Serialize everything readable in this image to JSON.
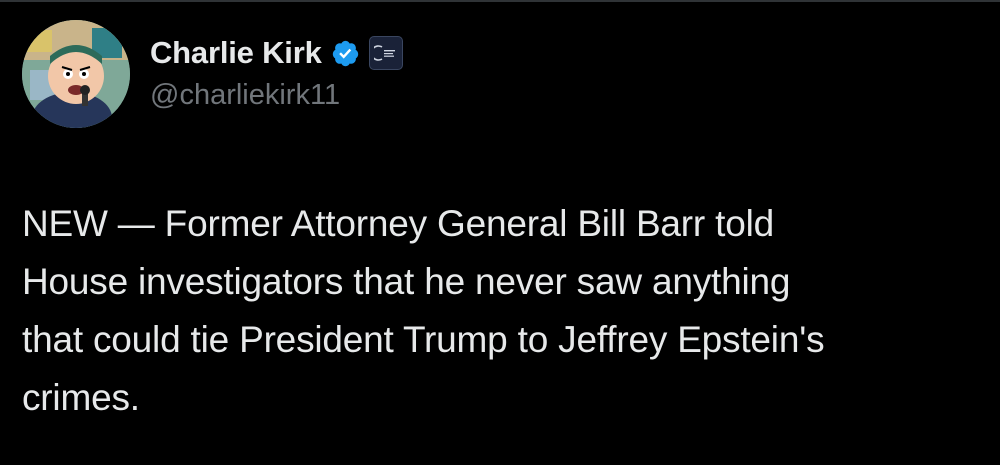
{
  "tweet": {
    "author": {
      "display_name": "Charlie Kirk",
      "handle": "@charliekirk11",
      "verified": true,
      "verified_icon": "verified-badge-icon",
      "affiliate_icon": "affiliate-org-icon",
      "avatar_icon": "cartoon-avatar-icon"
    },
    "text_lines": [
      "NEW — Former Attorney General Bill Barr told",
      "House investigators that he never saw anything",
      "that could tie President Trump to Jeffrey Epstein's",
      "crimes."
    ]
  },
  "colors": {
    "background": "#000000",
    "primary_text": "#e7e9ea",
    "secondary_text": "#71767b",
    "verified_blue": "#1d9bf0"
  }
}
